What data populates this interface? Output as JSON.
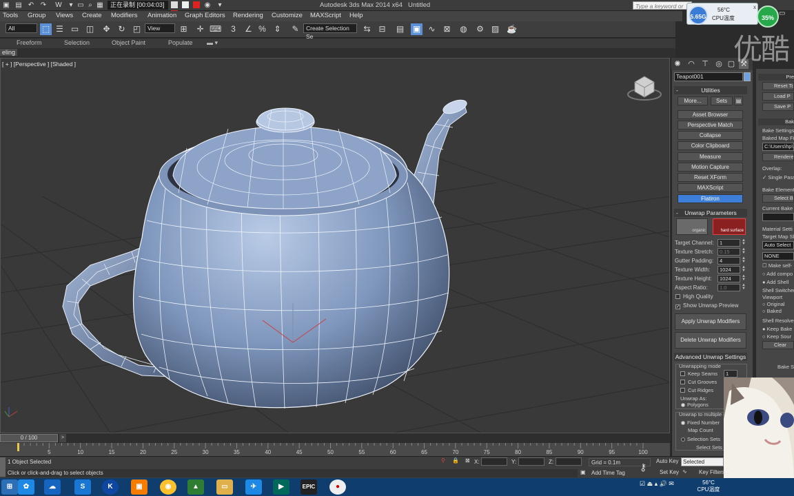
{
  "titlebar": {
    "recording_text": "正在录制 [00:04:03]",
    "app_title": "Autodesk 3ds Max  2014 x64",
    "doc_title": "Untitled",
    "search_placeholder": "Type a keyword or phrase"
  },
  "sys_widget": {
    "ghz": "5.65G",
    "temp": "56°C",
    "temp_label": "CPU温度",
    "close": "x",
    "usage": "35%"
  },
  "watermark": "优酷",
  "menu": [
    "Tools",
    "Group",
    "Views",
    "Create",
    "Modifiers",
    "Animation",
    "Graph Editors",
    "Rendering",
    "Customize",
    "MAXScript",
    "Help"
  ],
  "toolbar": {
    "filter_value": "All",
    "refcoord_value": "View",
    "selection_set_placeholder": "Create Selection Se"
  },
  "ribbon": {
    "tabs": [
      "Freeform",
      "Selection",
      "Object Paint",
      "Populate"
    ],
    "sub_label": "eling"
  },
  "viewport": {
    "label": "[ + ] [Perspective ] [Shaded ]"
  },
  "command_panel": {
    "object_name": "Teapot001",
    "object_color": "#6fa0e0",
    "utilities_title": "Utilities",
    "more_label": "More...",
    "sets_label": "Sets",
    "utilities": [
      "Asset Browser",
      "Perspective Match",
      "Collapse",
      "Color Clipboard",
      "Measure",
      "Motion Capture",
      "Reset XForm",
      "MAXScript",
      "Flatiron"
    ],
    "active_utility": "Flatiron",
    "unwrap_title": "Unwrap Parameters",
    "preset_organic": "organic",
    "preset_hard": "hard surface",
    "params": [
      {
        "label": "Target Channel:",
        "value": "1",
        "disabled": false
      },
      {
        "label": "Texture Stretch:",
        "value": "0.15",
        "disabled": true
      },
      {
        "label": "Gutter Padding:",
        "value": "4",
        "disabled": false
      },
      {
        "label": "Texture Width:",
        "value": "1024",
        "disabled": false
      },
      {
        "label": "Texture Height:",
        "value": "1024",
        "disabled": false
      },
      {
        "label": "Aspect Ratio:",
        "value": "1.0",
        "disabled": true
      }
    ],
    "high_quality_label": "High Quality",
    "show_preview_label": "Show Unwrap Preview",
    "apply_label": "Apply Unwrap Modifiers",
    "delete_label": "Delete Unwrap Modifiers",
    "advanced_title": "Advanced Unwrap Settings",
    "unwrapping_mode_label": "Unwrapping mode",
    "keep_seams_label": "Keep Seams",
    "keep_seams_value": "1",
    "cut_grooves_label": "Cut Grooves",
    "cut_ridges_label": "Cut Ridges",
    "unwrap_as_label": "Unwrap As:",
    "polygons_label": "Polygons",
    "multiple_label": "Unwrap to multiple m",
    "fixed_number_label": "Fixed Number",
    "map_count_label": "Map Count",
    "selection_sets_label": "Selection Sets",
    "select_sets_label": "Select Sets"
  },
  "right_panel": {
    "preset_head": "Pre",
    "reset_label": "Reset To",
    "load_label": "Load P",
    "save_label": "Save P",
    "bake_head": "Bak",
    "bake_settings_label": "Bake Settings",
    "baked_map_label": "Baked Map File",
    "baked_map_value": "C:\\Users\\hp\\",
    "renderer_label": "Renderer",
    "overlap_label": "Overlap:",
    "single_pass_label": "Single Pass",
    "bake_element_label": "Bake Element",
    "select_bake_label": "Select Bak",
    "current_bake_label": "Current Bake E",
    "material_settings_label": "Material Setti",
    "target_map_label": "Target Map Sl",
    "auto_select_value": "Auto Select",
    "none_value": "NONE",
    "make_self_label": "Make self-",
    "add_comp_label": "Add compo",
    "add_shell_label": "Add Shell",
    "shell_switcher_label": "Shell Switcher",
    "viewport_label": "Viewport",
    "original_label": "Original",
    "baked_label": "Baked",
    "shell_resolver_label": "Shell Resolver",
    "keep_bake_label": "Keep Bake",
    "keep_source_label": "Keep Sour",
    "clear_label": "Clear",
    "bake_se_label": "Bake Se"
  },
  "timeline": {
    "slider_text": "0 / 100",
    "ticks": [
      0,
      5,
      10,
      15,
      20,
      25,
      30,
      35,
      40,
      45,
      50,
      55,
      60,
      65,
      70,
      75,
      80,
      85,
      90,
      95,
      100
    ]
  },
  "status": {
    "selection": "1 Object Selected",
    "prompt": "Click or click-and-drag to select objects",
    "x_label": "X:",
    "y_label": "Y:",
    "z_label": "Z:",
    "grid": "Grid = 0.1m",
    "add_time_tag": "Add Time Tag",
    "auto_key": "Auto Key",
    "set_key": "Set Key",
    "selected_value": "Selected",
    "key_filters": "Key Filters..."
  },
  "taskbar": {
    "apps": [
      "start",
      "ie",
      "qq",
      "sogou",
      "kuwo",
      "orange-app",
      "chrome",
      "maxbrowser",
      "explorer",
      "arrow-app",
      "3dsmax",
      "epic",
      "recorder"
    ],
    "epic_label": "EPIC",
    "clock_temp": "56°C",
    "clock_label": "CPU温度"
  }
}
